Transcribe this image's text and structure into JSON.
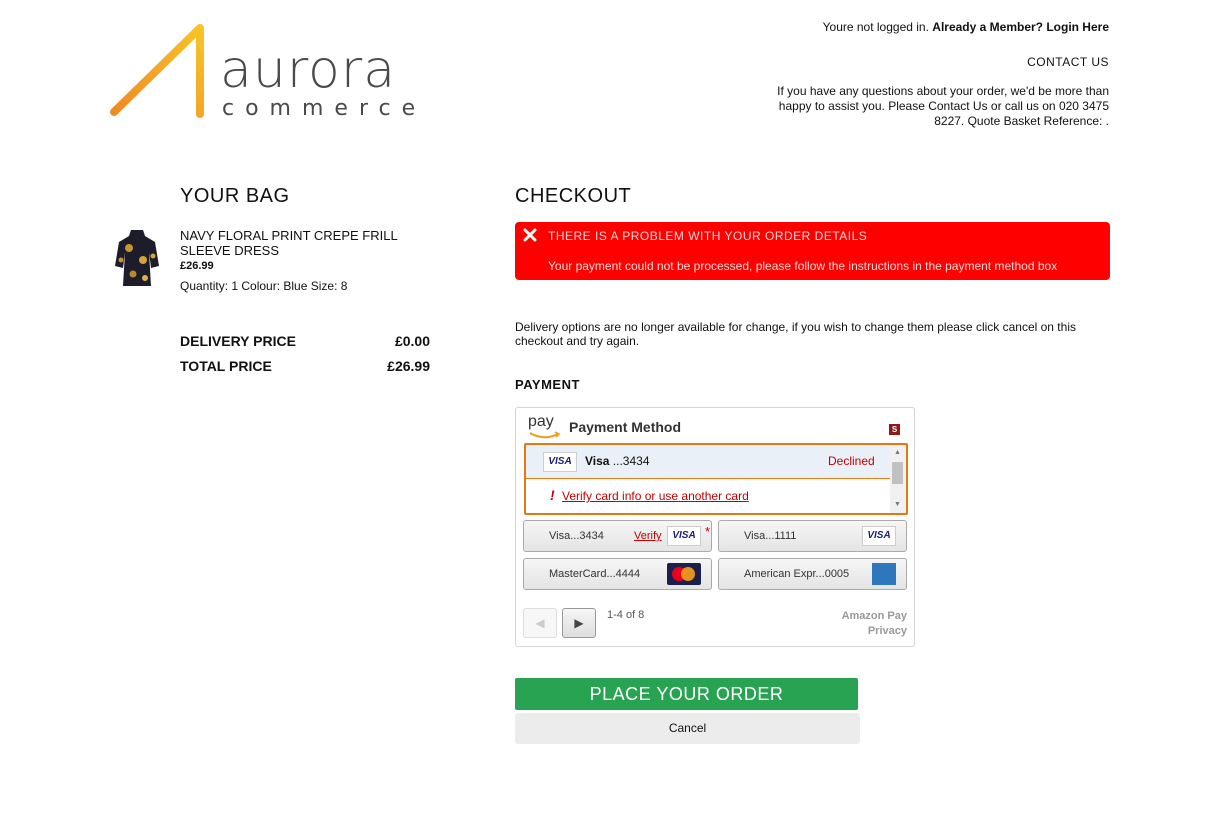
{
  "brand": {
    "name": "aurora",
    "sub": "commerce",
    "accent_start": "#f08a24",
    "accent_end": "#f6c427"
  },
  "header": {
    "login_prefix": "Youre not logged in.",
    "login_link": "Already a Member? Login Here",
    "contact_label": "CONTACT US",
    "contact_text": "If you have any questions about your order, we'd be more than happy to assist you. Please Contact Us or call us on 020 3475 8227. Quote Basket Reference: ."
  },
  "bag": {
    "title": "YOUR BAG",
    "product": {
      "name": "NAVY FLORAL PRINT CREPE FRILL SLEEVE DRESS",
      "price": "£26.99",
      "meta": "Quantity: 1 Colour: Blue Size: 8"
    },
    "delivery_label": "DELIVERY PRICE",
    "delivery_value": "£0.00",
    "total_label": "TOTAL PRICE",
    "total_value": "£26.99"
  },
  "checkout": {
    "title": "CHECKOUT",
    "error_title": "THERE IS A PROBLEM WITH YOUR ORDER DETAILS",
    "error_message": "Your payment could not be processed, please follow the instructions in the payment method box",
    "error_color": "#ff0000",
    "delivery_note": "Delivery options are no longer available for change, if you wish to change them please click cancel on this checkout and try again.",
    "payment_title": "PAYMENT",
    "place_order_label": "PLACE YOUR ORDER",
    "cancel_label": "Cancel",
    "place_order_color": "#27a351"
  },
  "widget": {
    "pay_logo_text": "pay",
    "title": "Payment Method",
    "badge": "S",
    "selected": {
      "card_logo": "VISA",
      "brand": "Visa",
      "last4": " ...3434",
      "status": "Declined",
      "warning_icon": "!",
      "warning_link": "Verify card info or use another card"
    },
    "cards": [
      {
        "label": "Visa",
        "suffix": "...3434",
        "logo": "VISA",
        "verify": "Verify",
        "star": "*"
      },
      {
        "label": "Visa",
        "suffix": "...1111",
        "logo": "VISA"
      },
      {
        "label": "MasterCard",
        "suffix": "...4444",
        "logo": "mastercard"
      },
      {
        "label": "American Expr",
        "suffix": "...0005",
        "logo": "AMERICAN EXPRESS"
      }
    ],
    "prev_icon": "◀",
    "next_icon": "▶",
    "page_count": "1-4 of 8",
    "amazon_pay_link": "Amazon Pay",
    "privacy_link": "Privacy",
    "scroll_up": "▲",
    "scroll_down": "▼"
  }
}
